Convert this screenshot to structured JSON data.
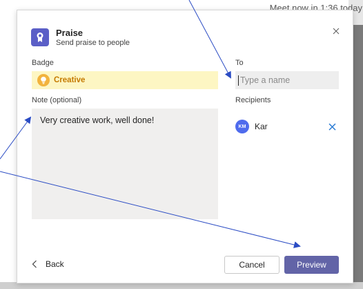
{
  "background": {
    "text": "Meet now in 1:36 today"
  },
  "dialog": {
    "title": "Praise",
    "subtitle": "Send praise to people",
    "close_icon": "close-icon"
  },
  "badge": {
    "label": "Badge",
    "value": "Creative",
    "icon": "lightbulb-icon"
  },
  "to": {
    "label": "To",
    "placeholder": "Type a name",
    "value": ""
  },
  "note": {
    "label": "Note (optional)",
    "value": "Very creative work, well done!"
  },
  "recipients": {
    "label": "Recipients",
    "items": [
      {
        "initials": "KM",
        "name": "Kar"
      }
    ]
  },
  "footer": {
    "back_label": "Back",
    "cancel_label": "Cancel",
    "preview_label": "Preview"
  },
  "colors": {
    "accent": "#6264a7",
    "badge_bg": "#fdf6c3",
    "badge_text": "#c57a00",
    "avatar": "#4f6bed",
    "annotation_arrow": "#2b4cc4"
  }
}
